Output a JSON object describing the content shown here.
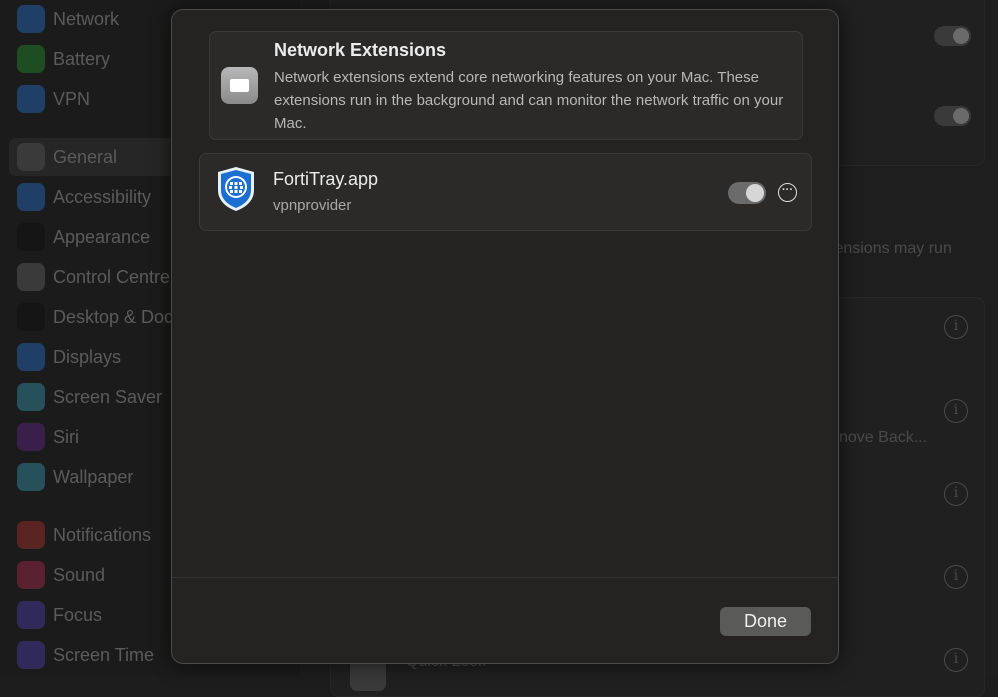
{
  "sidebar": {
    "items": [
      {
        "label": "Network",
        "icon": "globe-icon",
        "color": "#1f3f66"
      },
      {
        "label": "Battery",
        "icon": "battery-icon",
        "color": "#1f4d22"
      },
      {
        "label": "VPN",
        "icon": "vpn-globe-icon",
        "color": "#1f3f66"
      },
      {
        "label": "General",
        "icon": "gear-icon",
        "color": "#3a3a3a",
        "selected": true
      },
      {
        "label": "Accessibility",
        "icon": "accessibility-icon",
        "color": "#1f3f66"
      },
      {
        "label": "Appearance",
        "icon": "appearance-icon",
        "color": "#151515"
      },
      {
        "label": "Control Centre",
        "icon": "control-centre-icon",
        "color": "#3a3a3a"
      },
      {
        "label": "Desktop & Dock",
        "icon": "desktop-dock-icon",
        "color": "#151515"
      },
      {
        "label": "Displays",
        "icon": "sun-icon",
        "color": "#1f3f66"
      },
      {
        "label": "Screen Saver",
        "icon": "screen-saver-icon",
        "color": "#26505a"
      },
      {
        "label": "Siri",
        "icon": "siri-icon",
        "color": "#3a1f4a"
      },
      {
        "label": "Wallpaper",
        "icon": "flower-icon",
        "color": "#26505a"
      },
      {
        "label": "Notifications",
        "icon": "bell-icon",
        "color": "#5a2422"
      },
      {
        "label": "Sound",
        "icon": "speaker-icon",
        "color": "#5a2230"
      },
      {
        "label": "Focus",
        "icon": "moon-icon",
        "color": "#2f2a5a"
      },
      {
        "label": "Screen Time",
        "icon": "hourglass-icon",
        "color": "#2f2a5a"
      }
    ]
  },
  "background": {
    "text1": "tensions may run",
    "text2": "nove Back...",
    "text3": "Quick Look"
  },
  "sheet": {
    "header": {
      "title": "Network Extensions",
      "description": "Network extensions extend core networking features on your Mac. These extensions run in the background and can monitor the network traffic on your Mac.",
      "icon": "puzzle-extension-icon"
    },
    "extension": {
      "name": "FortiTray.app",
      "subtitle": "vpnprovider",
      "enabled": true,
      "icon": "fortinet-shield-icon",
      "more_glyph": "···"
    },
    "done_label": "Done"
  }
}
